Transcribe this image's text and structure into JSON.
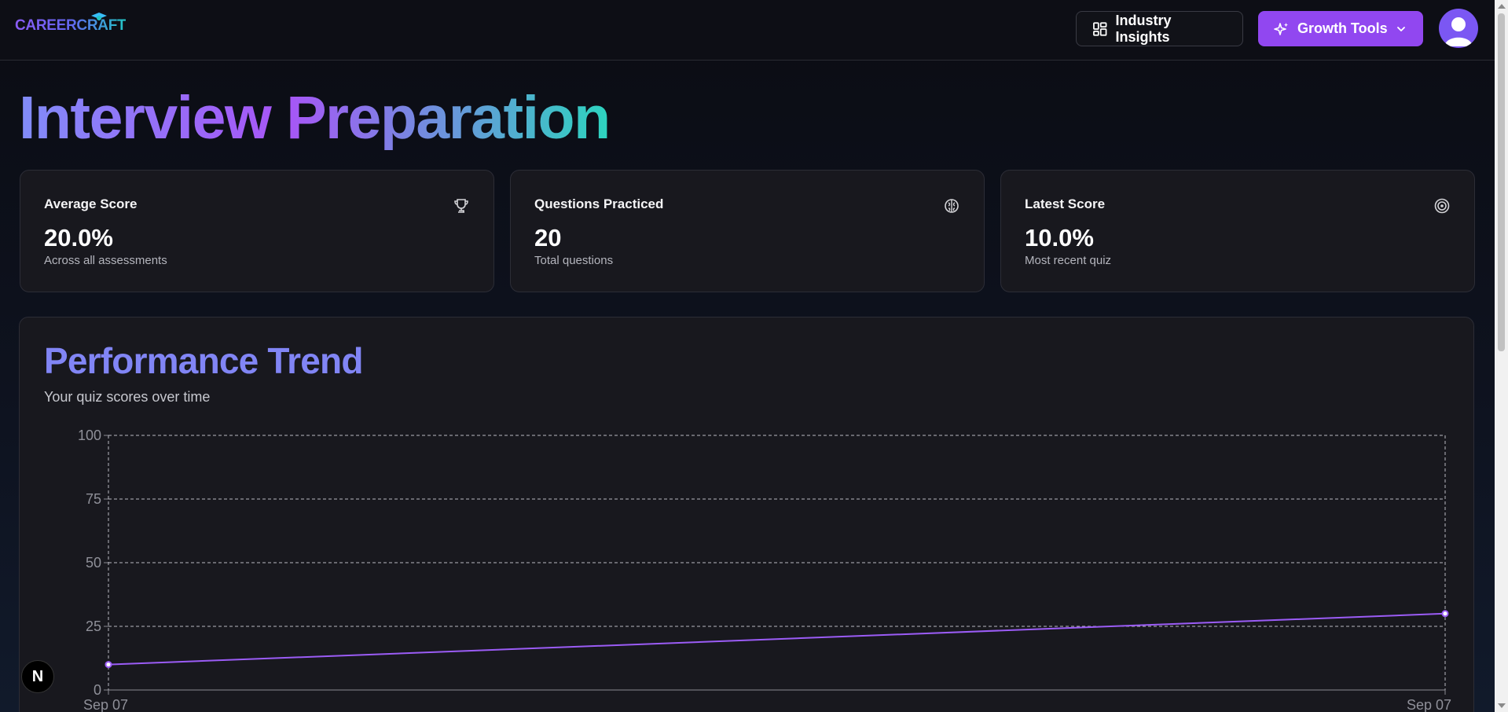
{
  "header": {
    "logo_text": "CAREERCRAFT",
    "industry_insights_label": "Industry Insights",
    "growth_tools_label": "Growth Tools"
  },
  "page": {
    "title_part1": "Interview",
    "title_part2": "Preparation"
  },
  "stats": [
    {
      "label": "Average Score",
      "value": "20.0%",
      "sub": "Across all assessments",
      "icon": "trophy-icon"
    },
    {
      "label": "Questions Practiced",
      "value": "20",
      "sub": "Total questions",
      "icon": "brain-icon"
    },
    {
      "label": "Latest Score",
      "value": "10.0%",
      "sub": "Most recent quiz",
      "icon": "target-icon"
    }
  ],
  "chart_section": {
    "title": "Performance Trend",
    "subtitle": "Your quiz scores over time"
  },
  "chart_data": {
    "type": "line",
    "x": [
      "Sep 07",
      "Sep 07"
    ],
    "series": [
      {
        "values": [
          10,
          30
        ]
      }
    ],
    "yticks": [
      0,
      25,
      50,
      75,
      100
    ],
    "ylim": [
      0,
      100
    ],
    "grid": true,
    "line_color": "#9b5cf6"
  },
  "badge": {
    "text": "N"
  },
  "colors": {
    "accent": "#9147f0",
    "card_bg": "#18181e",
    "chart_line": "#9b5cf6"
  }
}
